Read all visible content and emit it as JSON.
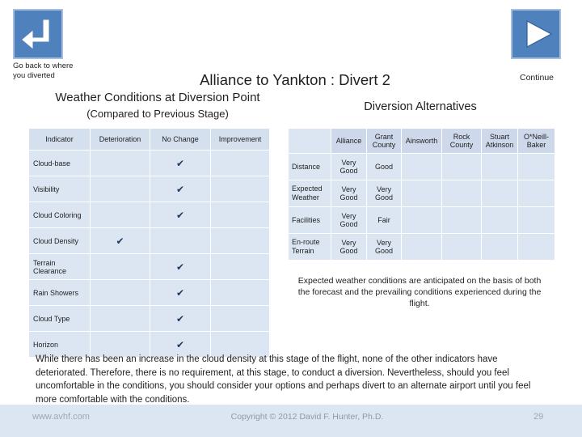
{
  "nav": {
    "back_icon": "back-arrow-icon",
    "back_label": "Go back to where you diverted",
    "continue_icon": "play-arrow-icon",
    "continue_label": "Continue"
  },
  "titles": {
    "main": "Alliance to Yankton : Divert 2",
    "left_heading": "Weather Conditions at Diversion Point",
    "left_subheading": "(Compared to Previous Stage)",
    "right_heading": "Diversion Alternatives"
  },
  "weather_table": {
    "headers": [
      "Indicator",
      "Deterioration",
      "No Change",
      "Improvement"
    ],
    "check_glyph": "✔",
    "rows": [
      {
        "indicator": "Cloud-base",
        "deterioration": "",
        "no_change": "✔",
        "improvement": ""
      },
      {
        "indicator": "Visibility",
        "deterioration": "",
        "no_change": "✔",
        "improvement": ""
      },
      {
        "indicator": "Cloud Coloring",
        "deterioration": "",
        "no_change": "✔",
        "improvement": ""
      },
      {
        "indicator": "Cloud Density",
        "deterioration": "✔",
        "no_change": "",
        "improvement": ""
      },
      {
        "indicator": "Terrain Clearance",
        "deterioration": "",
        "no_change": "✔",
        "improvement": ""
      },
      {
        "indicator": "Rain Showers",
        "deterioration": "",
        "no_change": "✔",
        "improvement": ""
      },
      {
        "indicator": "Cloud Type",
        "deterioration": "",
        "no_change": "✔",
        "improvement": ""
      },
      {
        "indicator": "Horizon",
        "deterioration": "",
        "no_change": "✔",
        "improvement": ""
      }
    ]
  },
  "alternatives_table": {
    "headers": [
      "",
      "Alliance",
      "Grant County",
      "Ainsworth",
      "Rock County",
      "Stuart Atkinson",
      "O*Neill-Baker"
    ],
    "rows": [
      {
        "label": "Distance",
        "values": [
          "Very Good",
          "Good",
          "",
          "",
          "",
          ""
        ]
      },
      {
        "label": "Expected Weather",
        "values": [
          "Very Good",
          "Very Good",
          "",
          "",
          "",
          ""
        ]
      },
      {
        "label": "Facilities",
        "values": [
          "Very Good",
          "Fair",
          "",
          "",
          "",
          ""
        ]
      },
      {
        "label": "En-route Terrain",
        "values": [
          "Very Good",
          "Very Good",
          "",
          "",
          "",
          ""
        ]
      }
    ]
  },
  "notes": {
    "weather_note": "Expected weather conditions are anticipated on the basis of both the forecast and the prevailing conditions experienced during the flight.",
    "summary": "While there has been an increase in the cloud density at this stage of the flight, none of the other indicators have deteriorated.  Therefore, there is no requirement, at this stage, to conduct a diversion. Nevertheless, should you feel uncomfortable in the conditions, you should consider your options and perhaps divert to an alternate airport until you feel more comfortable with the conditions."
  },
  "footer": {
    "website": "www.avhf.com",
    "copyright": "Copyright © 2012 David F. Hunter, Ph.D.",
    "page_number": "29"
  },
  "colors": {
    "accent": "#4f81bd",
    "table_fill": "#dce6f2",
    "header_fill": "#cdd9ea"
  }
}
